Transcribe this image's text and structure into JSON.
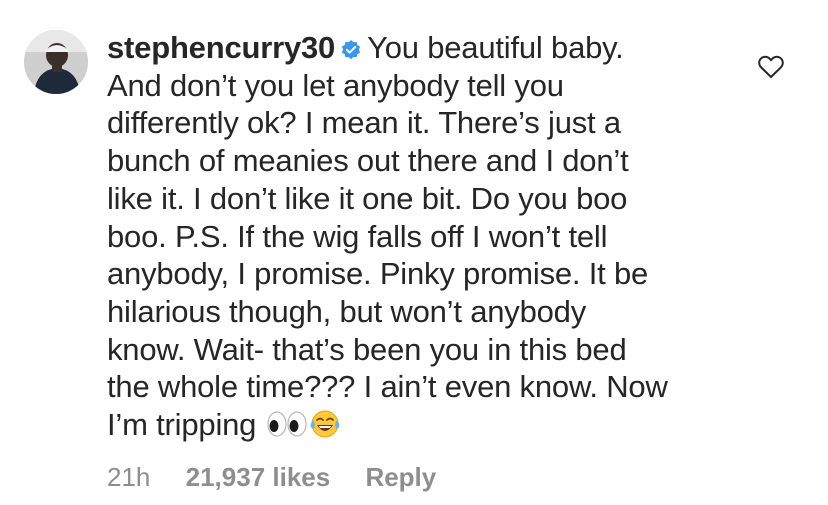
{
  "comment": {
    "username": "stephencurry30",
    "verified_icon": "verified-badge-icon",
    "text_lines": [
      "You beautiful baby.",
      "And don’t you let anybody tell you",
      "differently ok? I mean it. There’s just a",
      "bunch of meanies out there and I don’t",
      "like it. I don’t like it one bit. Do you boo",
      "boo. P.S. If the wig falls off I won’t tell",
      "anybody, I promise. Pinky promise. It be",
      "hilarious though, but won’t anybody",
      "know. Wait- that’s been you in this bed",
      "the whole time??? I ain’t even know. Now",
      "I’m tripping"
    ],
    "emojis": [
      "eyes-emoji",
      "tears-of-joy-emoji"
    ],
    "timestamp": "21h",
    "likes": "21,937 likes",
    "reply_label": "Reply",
    "like_icon": "heart-icon",
    "colors": {
      "text": "#262626",
      "meta": "#8e8e8e",
      "verified": "#3897f0"
    }
  }
}
